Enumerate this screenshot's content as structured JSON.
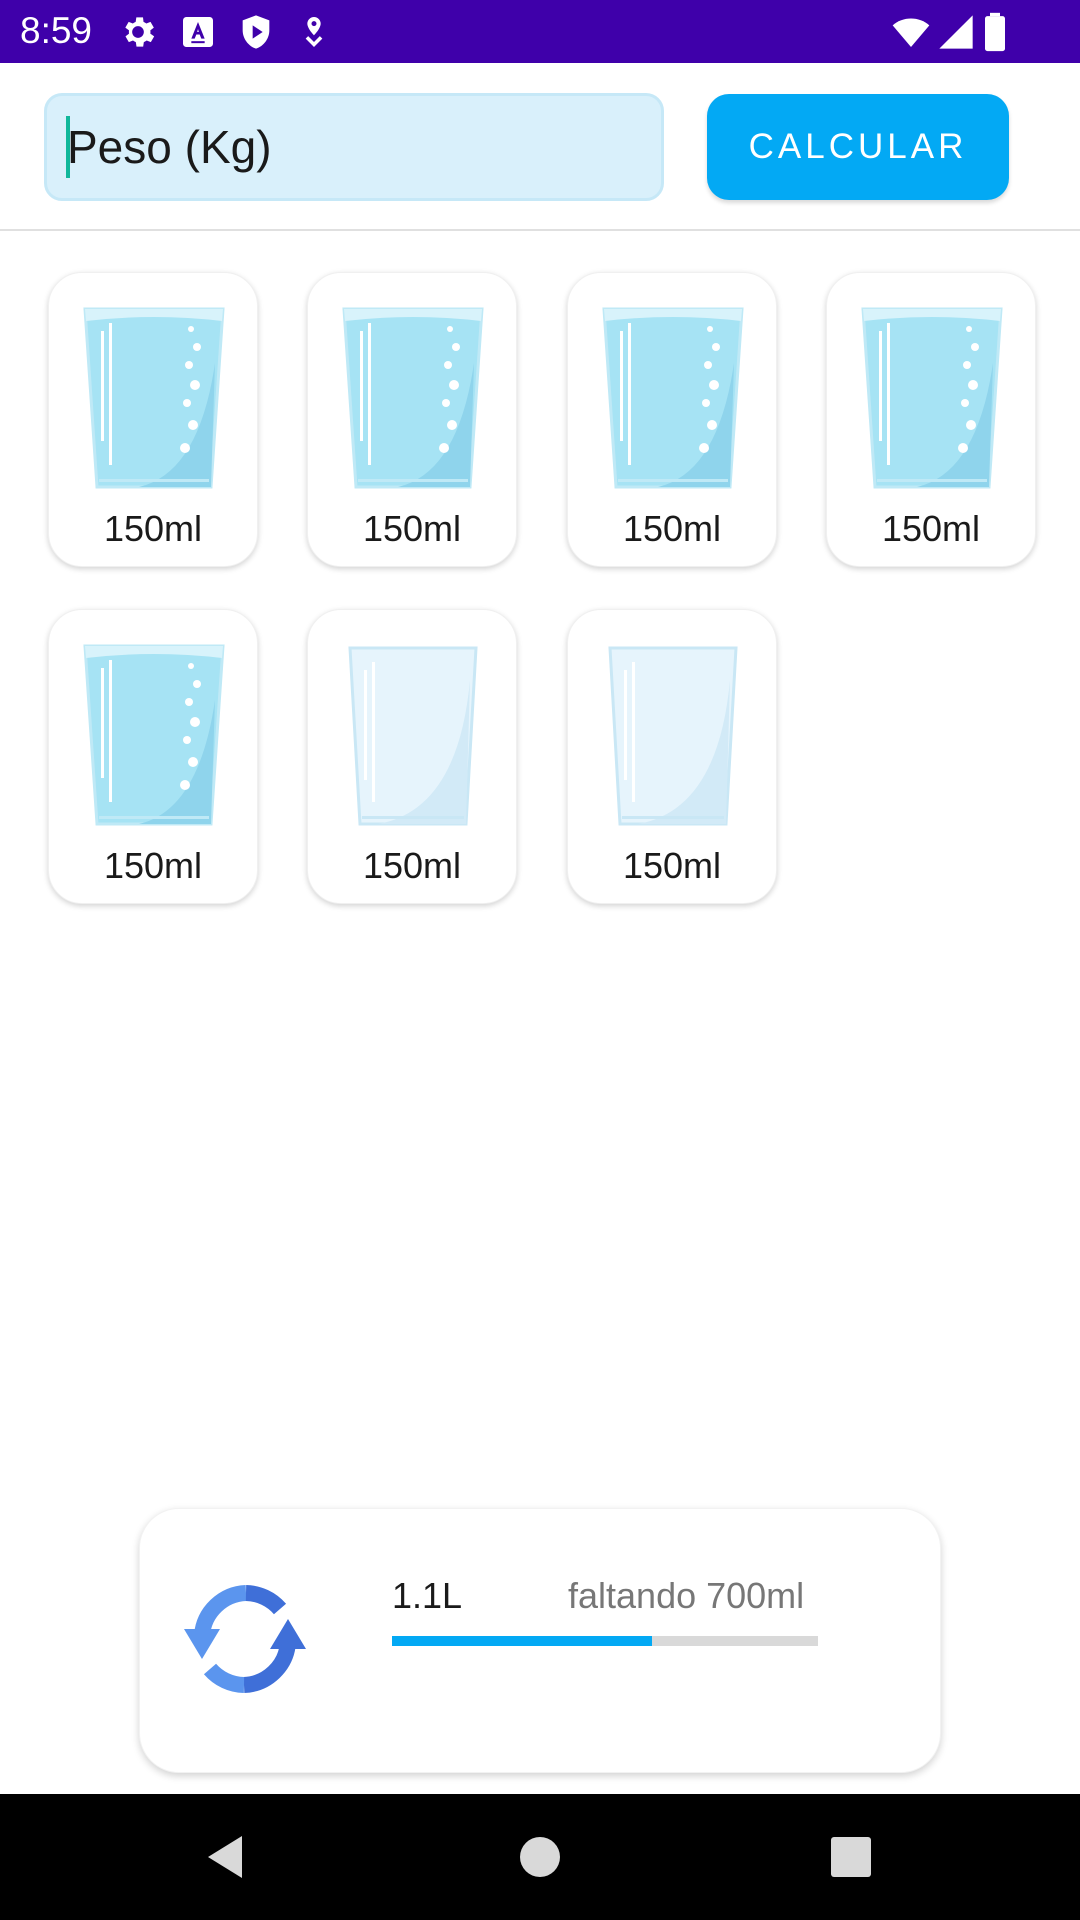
{
  "status_bar": {
    "time": "8:59",
    "left_icons": [
      "settings-icon",
      "keyboard-a-icon",
      "play-shield-icon",
      "location-pin-icon"
    ],
    "right_icons": [
      "wifi-icon",
      "signal-icon",
      "battery-icon"
    ],
    "background": "#3f00aa"
  },
  "header": {
    "weight_placeholder": "Peso (Kg)",
    "weight_value": "",
    "calculate_label": "CALCULAR",
    "accent": "#03a9f4"
  },
  "glasses": [
    {
      "label": "150ml",
      "filled": true
    },
    {
      "label": "150ml",
      "filled": true
    },
    {
      "label": "150ml",
      "filled": true
    },
    {
      "label": "150ml",
      "filled": true
    },
    {
      "label": "150ml",
      "filled": true
    },
    {
      "label": "150ml",
      "filled": false
    },
    {
      "label": "150ml",
      "filled": false
    }
  ],
  "summary": {
    "total": "1.1L",
    "remaining": "faltando 700ml",
    "progress_fraction": 0.61,
    "icon": "refresh-icon"
  },
  "nav": {
    "icons": [
      "back-icon",
      "home-icon",
      "recents-icon"
    ]
  }
}
